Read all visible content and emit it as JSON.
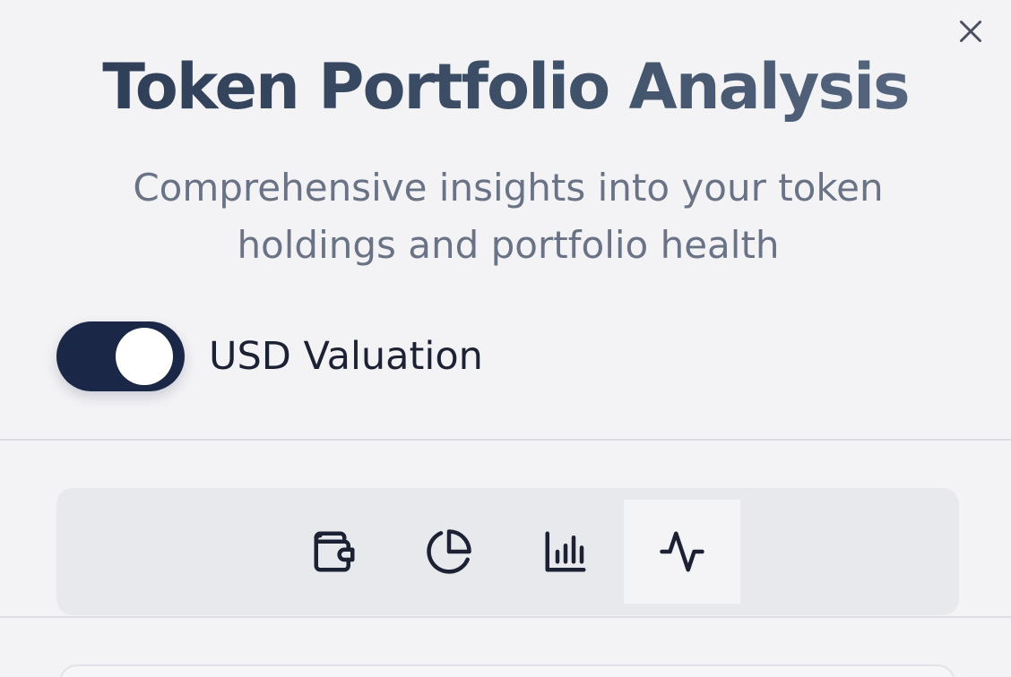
{
  "header": {
    "title": "Token Portfolio Analysis",
    "subtitle": "Comprehensive insights into your token holdings and portfolio health",
    "close_icon": "close-icon"
  },
  "settings": {
    "usd_toggle": {
      "label": "USD Valuation",
      "on": true
    }
  },
  "tabs": [
    {
      "icon": "wallet-icon",
      "active": false
    },
    {
      "icon": "pie-chart-icon",
      "active": false
    },
    {
      "icon": "bar-chart-icon",
      "active": false
    },
    {
      "icon": "activity-icon",
      "active": true
    }
  ],
  "colors": {
    "background": "#f3f3f6",
    "toggle_on": "#1b2747",
    "title": "#3a4a63",
    "subtitle": "#6a7385",
    "tab_bar": "#e8e9ed",
    "active_tab": "#f4f4f6"
  }
}
